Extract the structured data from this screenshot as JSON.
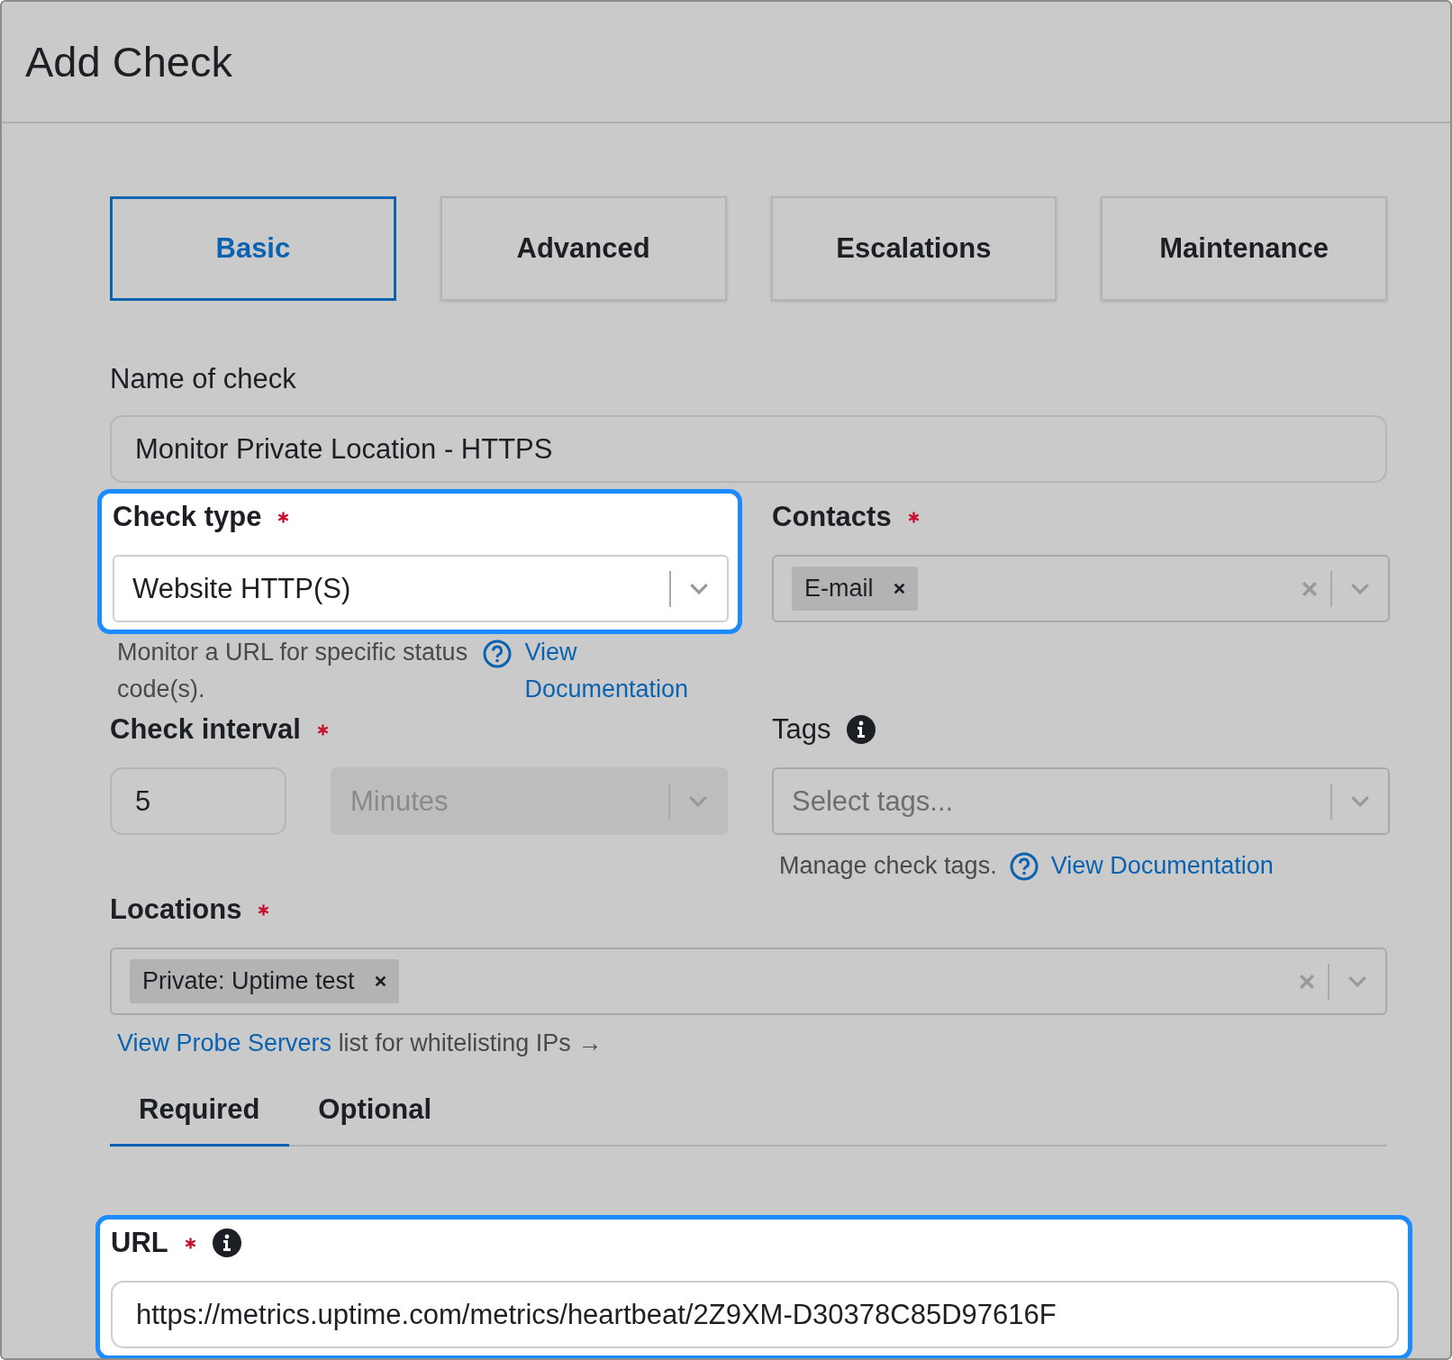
{
  "title": "Add Check",
  "tabs": [
    {
      "label": "Basic",
      "selected": true
    },
    {
      "label": "Advanced",
      "selected": false
    },
    {
      "label": "Escalations",
      "selected": false
    },
    {
      "label": "Maintenance",
      "selected": false
    }
  ],
  "name_field": {
    "label": "Name of check",
    "value": "Monitor Private Location - HTTPS"
  },
  "check_type": {
    "label": "Check type",
    "required": true,
    "highlighted": true,
    "value": "Website HTTP(S)",
    "help": "Monitor a URL for specific status code(s).",
    "link": "View Documentation"
  },
  "contacts": {
    "label": "Contacts",
    "required": true,
    "chips": [
      "E-mail"
    ]
  },
  "check_interval": {
    "label": "Check interval",
    "required": true,
    "value": "5",
    "unit": "Minutes",
    "unit_disabled": true
  },
  "tags": {
    "label": "Tags",
    "placeholder": "Select tags...",
    "help": "Manage check tags.",
    "link": "View Documentation"
  },
  "locations": {
    "label": "Locations",
    "required": true,
    "chips": [
      "Private: Uptime test"
    ]
  },
  "probe_note": {
    "link": "View Probe Servers",
    "text": "list for whitelisting IPs →"
  },
  "subtabs": [
    {
      "label": "Required",
      "selected": true
    },
    {
      "label": "Optional",
      "selected": false
    }
  ],
  "url": {
    "label": "URL",
    "required": true,
    "highlighted": true,
    "value": "https://metrics.uptime.com/metrics/heartbeat/2Z9XM-D30378C85D97616F"
  }
}
